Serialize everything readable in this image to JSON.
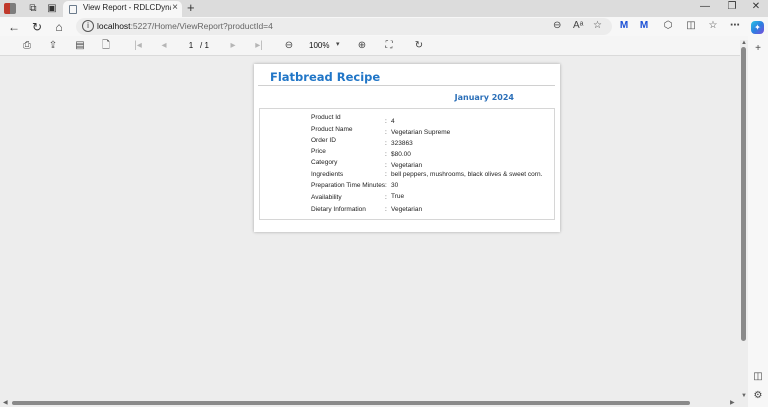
{
  "browser": {
    "tab_title": "View Report - RDLCDynamicBin",
    "tab_close": "×",
    "new_tab": "+",
    "url_host": "localhost",
    "url_path": ":5227/Home/ViewReport?productId=4",
    "window_controls": [
      "—",
      "❐",
      "✕"
    ]
  },
  "viewer": {
    "page_current": "1",
    "page_total": "/ 1",
    "zoom": "100%"
  },
  "report": {
    "title": "Flatbread Recipe",
    "date": "January 2024",
    "fields": [
      {
        "label": "Product Id",
        "value": "4"
      },
      {
        "label": "Product Name",
        "value": "Vegetarian Supreme"
      },
      {
        "label": "Order ID",
        "value": "323863"
      },
      {
        "label": "Price",
        "value": "$80.00"
      },
      {
        "label": "Category",
        "value": "Vegetarian"
      },
      {
        "label": "Ingredients",
        "value": "bell peppers, mushrooms, black olives & sweet corn."
      },
      {
        "label": "Preparation Time Minutes",
        "value": "30"
      },
      {
        "label": "Availability",
        "value": "True"
      },
      {
        "label": "Dietary Information",
        "value": "Vegetarian"
      }
    ]
  },
  "colors": {
    "title_blue": "#2176c7",
    "date_blue": "#2b6fb8"
  }
}
